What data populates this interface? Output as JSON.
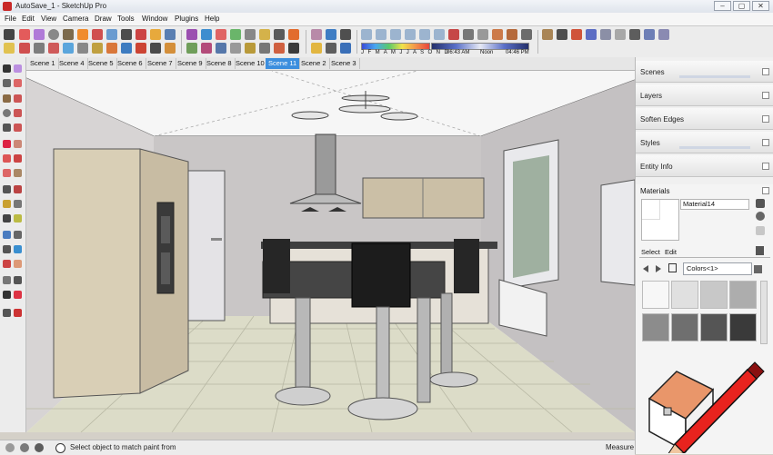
{
  "window": {
    "title": "AutoSave_1 - SketchUp Pro",
    "controls": {
      "minimize": "–",
      "maximize": "▢",
      "close": "✕"
    }
  },
  "menu": [
    "File",
    "Edit",
    "View",
    "Camera",
    "Draw",
    "Tools",
    "Window",
    "Plugins",
    "Help"
  ],
  "shadow_settings": {
    "months": "J F M A M J J A S O N D",
    "time_start": "06:43 AM",
    "time_mid": "Noon",
    "time_end": "04:46 PM"
  },
  "scenes": {
    "tabs": [
      "Scene 1",
      "Scene 4",
      "Scene 5",
      "Scene 6",
      "Scene 7",
      "Scene 9",
      "Scene 8",
      "Scene 10",
      "Scene 11",
      "Scene 2",
      "Scene 3"
    ],
    "active": "Scene 11"
  },
  "tray": {
    "panels": [
      "Scenes",
      "Layers",
      "Soften Edges",
      "Styles",
      "Entity Info"
    ],
    "materials": {
      "title": "Materials",
      "name_value": "Material14",
      "tabs": {
        "select": "Select",
        "edit": "Edit"
      },
      "library_select": "Colors<1>",
      "swatch_colors": [
        "#f7f7f7",
        "#e0e0e0",
        "#c8c8c8",
        "#adadad",
        "#8c8c8c",
        "#6f6f6f",
        "#555555",
        "#3a3a3a"
      ]
    }
  },
  "status": {
    "text": "Select object to match paint from",
    "measurements_label": "Measure"
  },
  "icons": {
    "paint_bucket": "paint-bucket-icon",
    "pencil_logo": "sketchup-pencil-logo"
  }
}
